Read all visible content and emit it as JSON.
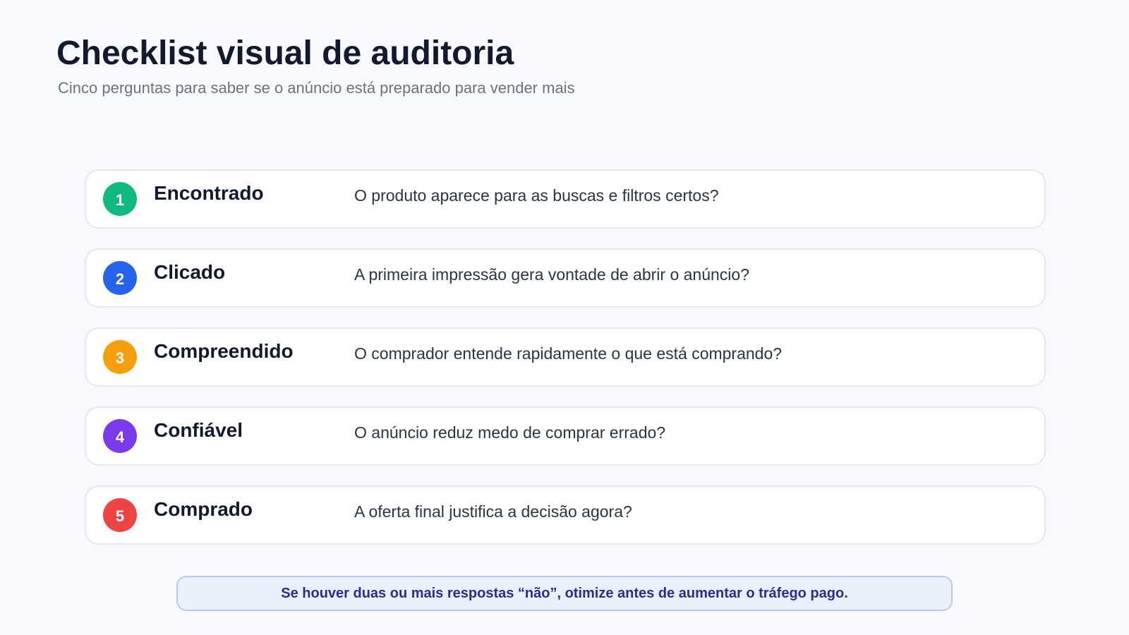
{
  "header": {
    "title": "Checklist visual de auditoria",
    "subtitle": "Cinco perguntas para saber se o anúncio está preparado para vender mais"
  },
  "items": [
    {
      "number": "1",
      "label": "Encontrado",
      "question": "O produto aparece para as buscas e filtros certos?",
      "color": "#10b981"
    },
    {
      "number": "2",
      "label": "Clicado",
      "question": "A primeira impressão gera vontade de abrir o anúncio?",
      "color": "#2563eb"
    },
    {
      "number": "3",
      "label": "Compreendido",
      "question": "O comprador entende rapidamente o que está comprando?",
      "color": "#f59e0b"
    },
    {
      "number": "4",
      "label": "Confiável",
      "question": "O anúncio reduz medo de comprar errado?",
      "color": "#7c3aed"
    },
    {
      "number": "5",
      "label": "Comprado",
      "question": "A oferta final justifica a decisão agora?",
      "color": "#ef4444"
    }
  ],
  "footer_note": "Se houver duas ou mais respostas “não”, otimize antes de aumentar o tráfego pago."
}
